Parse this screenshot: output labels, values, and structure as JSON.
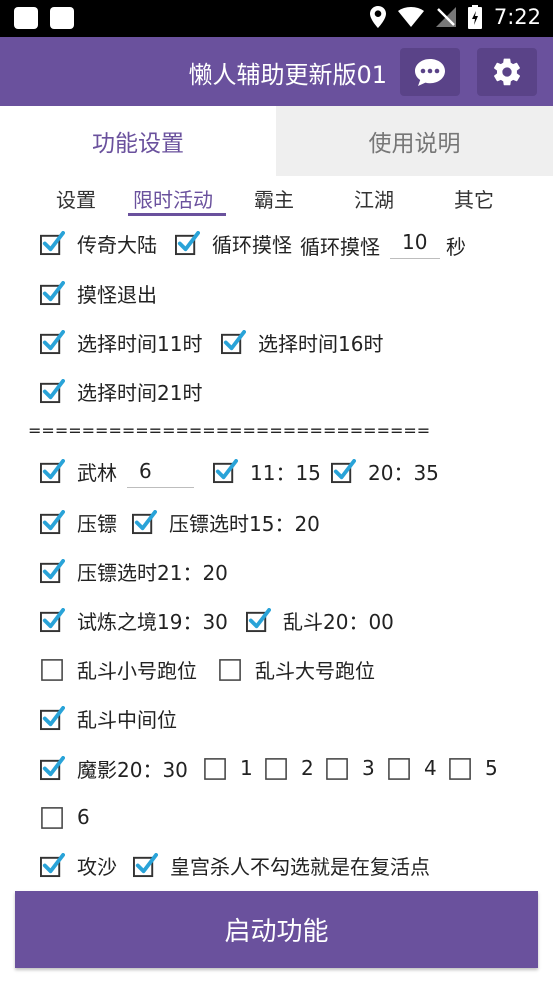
{
  "status_bar": {
    "time": "7:22"
  },
  "app_bar": {
    "title": "懒人辅助更新版01",
    "chat_icon": "chat-icon",
    "settings_icon": "gear-icon"
  },
  "tabs": [
    "功能设置",
    "使用说明"
  ],
  "subtabs": [
    "设置",
    "限时活动",
    "霸主",
    "江湖",
    "其它"
  ],
  "labels": {
    "chuanqi": "传奇大陆",
    "loop_cb": "循环摸怪",
    "loop_text": "循环摸怪",
    "loop_value": "10",
    "loop_unit": "秒",
    "exit": "摸怪退出",
    "t11": "选择时间11时",
    "t16": "选择时间16时",
    "t21": "选择时间21时",
    "separator": "==============================",
    "wulin": "武林",
    "wulin_value": "6",
    "w1115": "11：15",
    "w2035": "20：35",
    "yabiao": "压镖",
    "yb1520": "压镖选时15：20",
    "yb2120": "压镖选时21：20",
    "shilian": "试炼之境19：30",
    "luandou": "乱斗20：00",
    "ld_small": "乱斗小号跑位",
    "ld_big": "乱斗大号跑位",
    "ld_mid": "乱斗中间位",
    "moying": "魔影20：30",
    "m1": "1",
    "m2": "2",
    "m3": "3",
    "m4": "4",
    "m5": "5",
    "m6": "6",
    "gongsha": "攻沙",
    "palace": "皇宫杀人不勾选就是在复活点"
  },
  "start_button": "启动功能",
  "colors": {
    "primary": "#6a519d",
    "check": "#29a3d8"
  }
}
